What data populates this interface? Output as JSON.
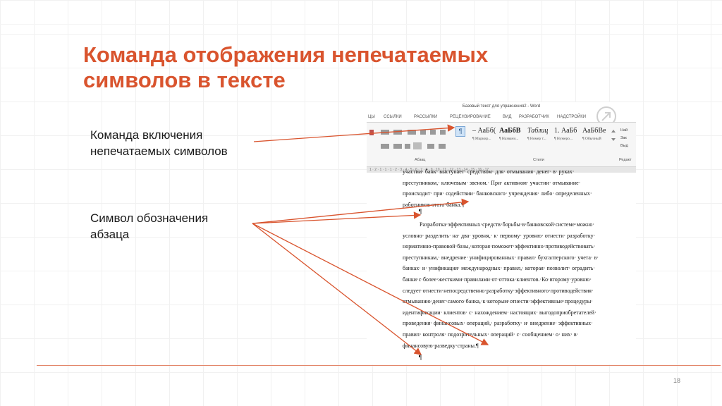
{
  "slide": {
    "title_line1": "Команда отображения непечатаемых",
    "title_line2": "символов в тексте",
    "label1_line1": "Команда включения",
    "label1_line2": "непечатаемых символов",
    "label2_line1": "Символ обозначения",
    "label2_line2": "абзаца",
    "page_number": "18"
  },
  "word": {
    "window_title": "Базовый текст для упражнения2 - Word",
    "tabs": [
      "ЦЫ",
      "ССЫЛКИ",
      "РАССЫЛКИ",
      "РЕЦЕНЗИРОВАНИЕ",
      "ВИД",
      "РАЗРАБОТЧИК",
      "НАДСТРОЙКИ"
    ],
    "pilcrow_button": "¶",
    "group_paragraph": "Абзац",
    "group_styles": "Стили",
    "group_edit": "Редакт",
    "styles": [
      {
        "sample": "– АаБб(",
        "name": "¶ Маркир..."
      },
      {
        "sample": "АаБбВ",
        "name": "¶ Названи..."
      },
      {
        "sample": "Таблиц",
        "name": "¶ Номер т..."
      },
      {
        "sample": "1. АаБб",
        "name": "¶ Нумеро..."
      },
      {
        "sample": "АаБбВе",
        "name": "¶ Обычный"
      }
    ],
    "edit_items": [
      "Най",
      "Зак",
      "Выд"
    ],
    "ruler_text": "1 · 2 · 1 · 1 · 1 · 2 · 3 · 4 · 5 · 6 · 7 · 8 · 9 · 10 · 11 · 12 · 13 · 14 · 15 · 16 · 17",
    "paragraph1": [
      "участии· банк· выступает· средством· для· отмывания· денег· в· руках·",
      "преступником,· ключевым· звеном.· При· активном· участии· отмывание·",
      "происходит· при· содействии· банковского· учреждения· либо· определенных·",
      "работников·этого·банка.¶"
    ],
    "empty_paragraph_mark": "¶",
    "paragraph2": [
      "Разработка·эффективных·средств·борьбы·в·банковской·системе·можно·",
      "условно· разделить· на· два· уровня,· к· первому· уровню· отнести· разработку·",
      "нормативно-правовой·базы,·которая·поможет·эффективно·противодействовать·",
      "преступникам,· внедрение· унифицированных· правил· бухгалтерского· учета· в·",
      "банках· и· унификация· международных· правил,· которая· позволит· оградить·",
      "банки·с·более·жесткими·правилами·от·оттока·клиентов.·Ко·второму·уровню·",
      "следует·отнести·непосредственно·разработку·эффективного·противодействия·",
      "отмыванию·денег·самого·банка,·к·которым·отнести·эффективные·процедуры·",
      "идентификации· клиентов· с· нахождением· настоящих· выгодоприобретателей·",
      "проведения· финансовых· операций,· разработку· и· внедрение· эффективных·",
      "правил· контроля· подозрительных· операций· с· сообщением· о· них· в·",
      "финансовую·разведку·страны.¶"
    ],
    "final_mark": "¶"
  },
  "colors": {
    "accent": "#d9542e",
    "arrow": "#d9542e",
    "rule": "#e3866a"
  }
}
